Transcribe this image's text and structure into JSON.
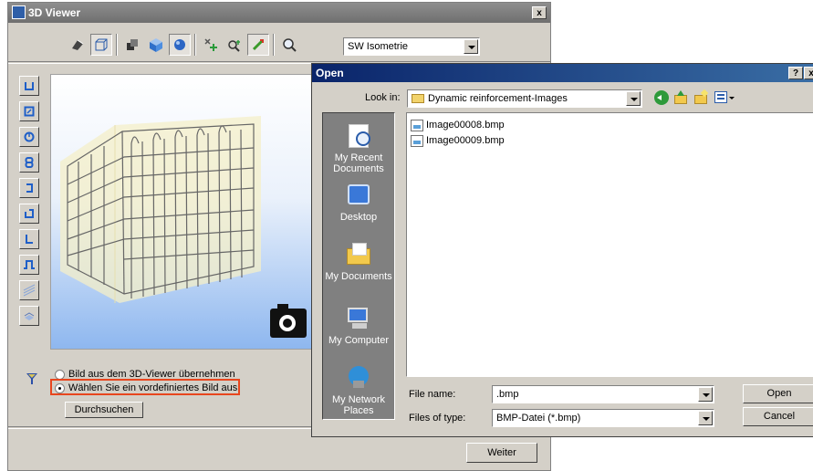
{
  "viewer": {
    "title": "3D Viewer",
    "close_symbol": "x",
    "view_combo": {
      "value": "SW Isometrie"
    },
    "toolbar_icons": [
      "rotate-icon",
      "wireframe-box-icon",
      "hidden-line-icon",
      "shaded-cube-icon",
      "sphere-icon",
      "zoom-add-icon",
      "zoom-region-icon",
      "pan-icon",
      "zoom-icon"
    ],
    "side_icons": [
      "stirrup-u-icon",
      "stirrup-closed-icon",
      "stirrup-round-icon",
      "stirrup-double-icon",
      "stirrup-hook-icon",
      "stirrup-open-icon",
      "stirrup-l-icon",
      "stirrup-wave-icon",
      "mesh-icon",
      "mesh-3d-icon"
    ],
    "filter_icon": "funnel-icon",
    "camera_icon": "camera-icon",
    "option_take": "Bild aus dem 3D-Viewer übernehmen",
    "option_choose": "Wählen Sie ein vordefiniertes Bild aus",
    "browse_label": "Durchsuchen",
    "next_label": "Weiter",
    "highlight_color": "#e8461e"
  },
  "open_dialog": {
    "title": "Open",
    "help_symbol": "?",
    "close_symbol": "x",
    "look_in_label": "Look in:",
    "look_in_value": "Dynamic reinforcement-Images",
    "places": [
      "My Recent Documents",
      "Desktop",
      "My Documents",
      "My Computer",
      "My Network Places"
    ],
    "files": [
      "Image00008.bmp",
      "Image00009.bmp"
    ],
    "file_name_label": "File name:",
    "file_name_value": ".bmp",
    "file_type_label": "Files of type:",
    "file_type_value": "BMP-Datei (*.bmp)",
    "open_label": "Open",
    "cancel_label": "Cancel"
  }
}
